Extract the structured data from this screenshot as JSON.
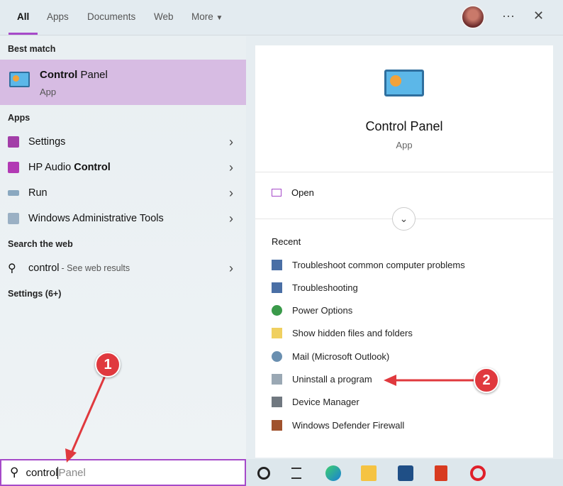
{
  "tabs": [
    "All",
    "Apps",
    "Documents",
    "Web",
    "More"
  ],
  "window_controls": {
    "more": "···",
    "close": "✕"
  },
  "left": {
    "best_match_header": "Best match",
    "best_match": {
      "title_bold": "Control",
      "title_rest": " Panel",
      "subtitle": "App"
    },
    "apps_header": "Apps",
    "apps": [
      {
        "pre": "",
        "bold": "",
        "label": "Settings",
        "color": "#a23ea8"
      },
      {
        "pre": "HP Audio ",
        "bold": "Control",
        "label": "",
        "color": "#b23ab4"
      },
      {
        "pre": "",
        "bold": "",
        "label": "Run",
        "color": "#8aa8c0"
      },
      {
        "pre": "",
        "bold": "",
        "label": "Windows Administrative Tools",
        "color": "#9ab0c4"
      }
    ],
    "web_header": "Search the web",
    "web": {
      "query": "control",
      "hint": " - See web results"
    },
    "settings_header": "Settings (6+)"
  },
  "right": {
    "title": "Control Panel",
    "subtitle": "App",
    "open": "Open",
    "recent_header": "Recent",
    "recent": [
      "Troubleshoot common computer problems",
      "Troubleshooting",
      "Power Options",
      "Show hidden files and folders",
      "Mail (Microsoft Outlook)",
      "Uninstall a program",
      "Device Manager",
      "Windows Defender Firewall"
    ]
  },
  "search": {
    "typed": "control",
    "suggestion": "Panel"
  },
  "annotations": {
    "one": "1",
    "two": "2"
  },
  "colors": {
    "accent": "#a64ac9",
    "highlight": "#d7bce3",
    "annotation": "#e0393e"
  }
}
